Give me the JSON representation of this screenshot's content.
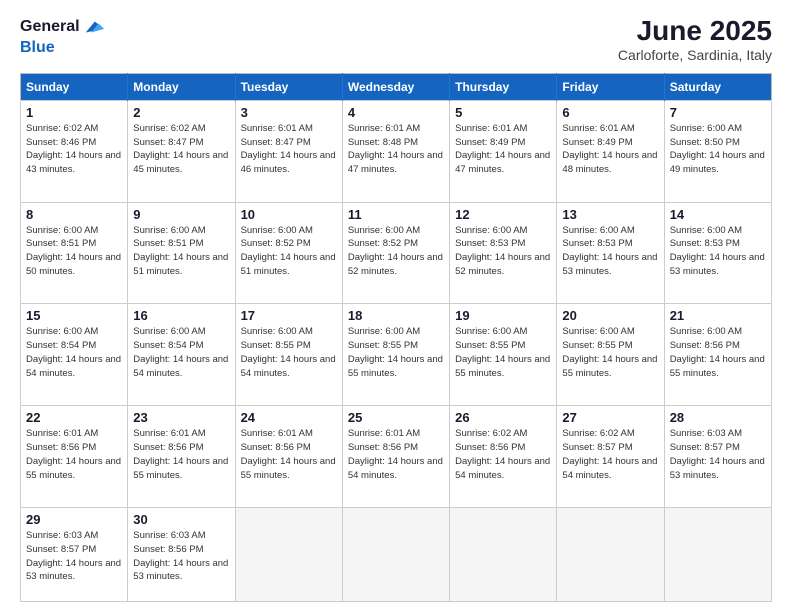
{
  "header": {
    "logo_line1": "General",
    "logo_line2": "Blue",
    "month_year": "June 2025",
    "location": "Carloforte, Sardinia, Italy"
  },
  "days_of_week": [
    "Sunday",
    "Monday",
    "Tuesday",
    "Wednesday",
    "Thursday",
    "Friday",
    "Saturday"
  ],
  "weeks": [
    [
      {
        "day": 1,
        "sunrise": "6:02 AM",
        "sunset": "8:46 PM",
        "daylight": "14 hours and 43 minutes."
      },
      {
        "day": 2,
        "sunrise": "6:02 AM",
        "sunset": "8:47 PM",
        "daylight": "14 hours and 45 minutes."
      },
      {
        "day": 3,
        "sunrise": "6:01 AM",
        "sunset": "8:47 PM",
        "daylight": "14 hours and 46 minutes."
      },
      {
        "day": 4,
        "sunrise": "6:01 AM",
        "sunset": "8:48 PM",
        "daylight": "14 hours and 47 minutes."
      },
      {
        "day": 5,
        "sunrise": "6:01 AM",
        "sunset": "8:49 PM",
        "daylight": "14 hours and 47 minutes."
      },
      {
        "day": 6,
        "sunrise": "6:01 AM",
        "sunset": "8:49 PM",
        "daylight": "14 hours and 48 minutes."
      },
      {
        "day": 7,
        "sunrise": "6:00 AM",
        "sunset": "8:50 PM",
        "daylight": "14 hours and 49 minutes."
      }
    ],
    [
      {
        "day": 8,
        "sunrise": "6:00 AM",
        "sunset": "8:51 PM",
        "daylight": "14 hours and 50 minutes."
      },
      {
        "day": 9,
        "sunrise": "6:00 AM",
        "sunset": "8:51 PM",
        "daylight": "14 hours and 51 minutes."
      },
      {
        "day": 10,
        "sunrise": "6:00 AM",
        "sunset": "8:52 PM",
        "daylight": "14 hours and 51 minutes."
      },
      {
        "day": 11,
        "sunrise": "6:00 AM",
        "sunset": "8:52 PM",
        "daylight": "14 hours and 52 minutes."
      },
      {
        "day": 12,
        "sunrise": "6:00 AM",
        "sunset": "8:53 PM",
        "daylight": "14 hours and 52 minutes."
      },
      {
        "day": 13,
        "sunrise": "6:00 AM",
        "sunset": "8:53 PM",
        "daylight": "14 hours and 53 minutes."
      },
      {
        "day": 14,
        "sunrise": "6:00 AM",
        "sunset": "8:53 PM",
        "daylight": "14 hours and 53 minutes."
      }
    ],
    [
      {
        "day": 15,
        "sunrise": "6:00 AM",
        "sunset": "8:54 PM",
        "daylight": "14 hours and 54 minutes."
      },
      {
        "day": 16,
        "sunrise": "6:00 AM",
        "sunset": "8:54 PM",
        "daylight": "14 hours and 54 minutes."
      },
      {
        "day": 17,
        "sunrise": "6:00 AM",
        "sunset": "8:55 PM",
        "daylight": "14 hours and 54 minutes."
      },
      {
        "day": 18,
        "sunrise": "6:00 AM",
        "sunset": "8:55 PM",
        "daylight": "14 hours and 55 minutes."
      },
      {
        "day": 19,
        "sunrise": "6:00 AM",
        "sunset": "8:55 PM",
        "daylight": "14 hours and 55 minutes."
      },
      {
        "day": 20,
        "sunrise": "6:00 AM",
        "sunset": "8:55 PM",
        "daylight": "14 hours and 55 minutes."
      },
      {
        "day": 21,
        "sunrise": "6:00 AM",
        "sunset": "8:56 PM",
        "daylight": "14 hours and 55 minutes."
      }
    ],
    [
      {
        "day": 22,
        "sunrise": "6:01 AM",
        "sunset": "8:56 PM",
        "daylight": "14 hours and 55 minutes."
      },
      {
        "day": 23,
        "sunrise": "6:01 AM",
        "sunset": "8:56 PM",
        "daylight": "14 hours and 55 minutes."
      },
      {
        "day": 24,
        "sunrise": "6:01 AM",
        "sunset": "8:56 PM",
        "daylight": "14 hours and 55 minutes."
      },
      {
        "day": 25,
        "sunrise": "6:01 AM",
        "sunset": "8:56 PM",
        "daylight": "14 hours and 54 minutes."
      },
      {
        "day": 26,
        "sunrise": "6:02 AM",
        "sunset": "8:56 PM",
        "daylight": "14 hours and 54 minutes."
      },
      {
        "day": 27,
        "sunrise": "6:02 AM",
        "sunset": "8:57 PM",
        "daylight": "14 hours and 54 minutes."
      },
      {
        "day": 28,
        "sunrise": "6:03 AM",
        "sunset": "8:57 PM",
        "daylight": "14 hours and 53 minutes."
      }
    ],
    [
      {
        "day": 29,
        "sunrise": "6:03 AM",
        "sunset": "8:57 PM",
        "daylight": "14 hours and 53 minutes."
      },
      {
        "day": 30,
        "sunrise": "6:03 AM",
        "sunset": "8:56 PM",
        "daylight": "14 hours and 53 minutes."
      },
      null,
      null,
      null,
      null,
      null
    ]
  ]
}
